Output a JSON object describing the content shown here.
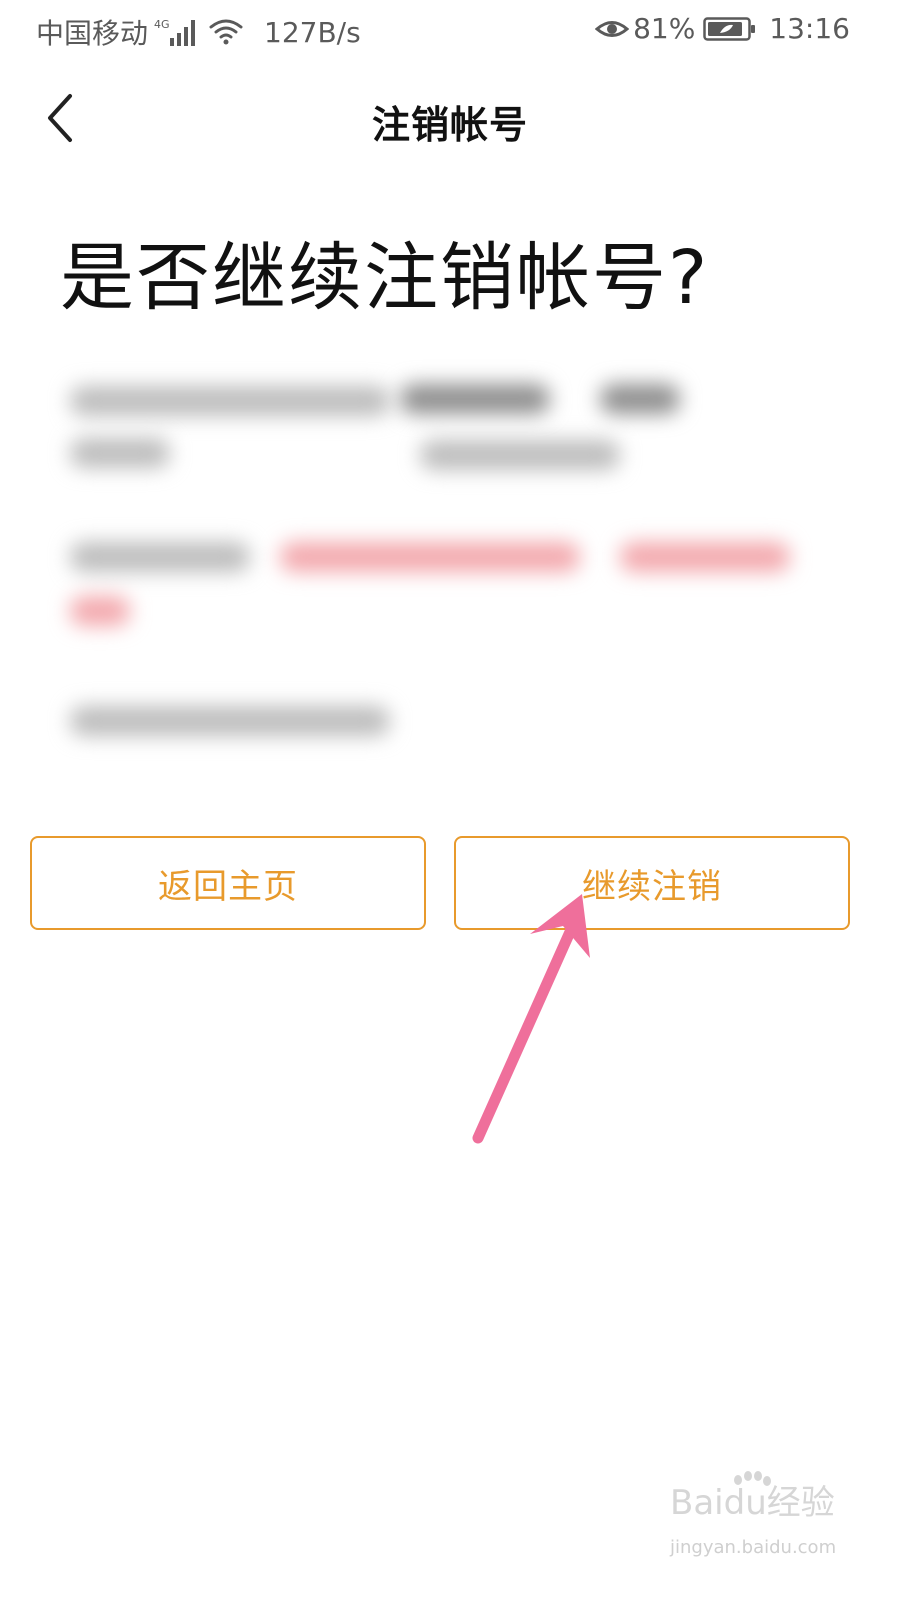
{
  "status_bar": {
    "carrier": "中国移动",
    "network_type": "4G",
    "speed": "127B/s",
    "battery": "81%",
    "time": "13:16",
    "icons": [
      "signal-icon",
      "wifi-icon",
      "eye-icon",
      "battery-icon"
    ]
  },
  "nav": {
    "title": "注销帐号",
    "back_icon": "chevron-left-icon"
  },
  "main": {
    "heading": "是否继续注销帐号?"
  },
  "buttons": {
    "home_label": "返回主页",
    "continue_label": "继续注销"
  },
  "colors": {
    "accent": "#e89a2c",
    "annotation_arrow": "#ef6f9b",
    "text": "#111111",
    "status_text": "#5a5a5a"
  },
  "watermark": {
    "logo": "Baidu经验",
    "url": "jingyan.baidu.com"
  }
}
